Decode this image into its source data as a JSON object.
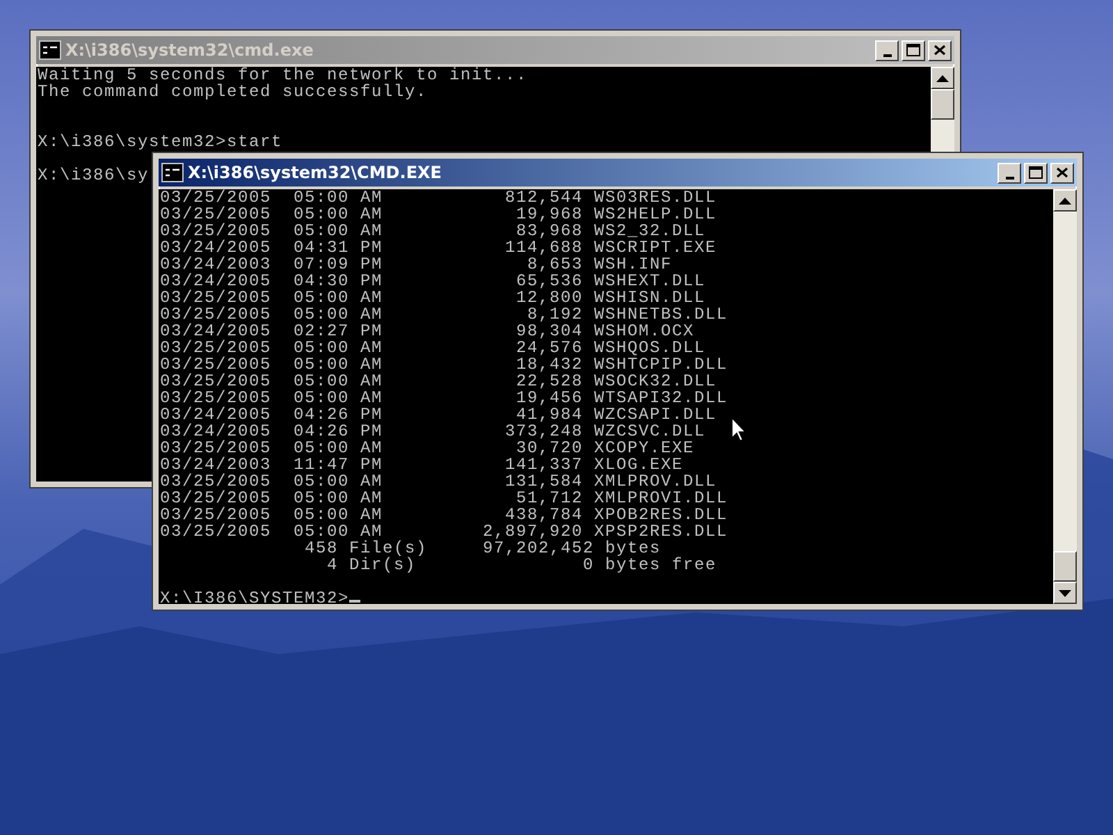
{
  "windows": [
    {
      "title": "X:\\i386\\system32\\cmd.exe",
      "active": false,
      "lines": [
        {
          "kind": "text",
          "text": "Waiting 5 seconds for the network to init..."
        },
        {
          "kind": "text",
          "text": "The command completed successfully."
        },
        {
          "kind": "blank"
        },
        {
          "kind": "blank"
        },
        {
          "kind": "text",
          "text": "X:\\i386\\system32>start"
        },
        {
          "kind": "blank"
        },
        {
          "kind": "text",
          "text": "X:\\i386\\sy"
        }
      ]
    },
    {
      "title": "X:\\i386\\system32\\CMD.EXE",
      "active": true,
      "lines": [
        {
          "kind": "text",
          "text": "03/25/2005  05:00 AM           812,544 WS03RES.DLL"
        },
        {
          "kind": "text",
          "text": "03/25/2005  05:00 AM            19,968 WS2HELP.DLL"
        },
        {
          "kind": "text",
          "text": "03/25/2005  05:00 AM            83,968 WS2_32.DLL"
        },
        {
          "kind": "text",
          "text": "03/24/2005  04:31 PM           114,688 WSCRIPT.EXE"
        },
        {
          "kind": "text",
          "text": "03/24/2003  07:09 PM             8,653 WSH.INF"
        },
        {
          "kind": "text",
          "text": "03/24/2005  04:30 PM            65,536 WSHEXT.DLL"
        },
        {
          "kind": "text",
          "text": "03/25/2005  05:00 AM            12,800 WSHISN.DLL"
        },
        {
          "kind": "text",
          "text": "03/25/2005  05:00 AM             8,192 WSHNETBS.DLL"
        },
        {
          "kind": "text",
          "text": "03/24/2005  02:27 PM            98,304 WSHOM.OCX"
        },
        {
          "kind": "text",
          "text": "03/25/2005  05:00 AM            24,576 WSHQOS.DLL"
        },
        {
          "kind": "text",
          "text": "03/25/2005  05:00 AM            18,432 WSHTCPIP.DLL"
        },
        {
          "kind": "text",
          "text": "03/25/2005  05:00 AM            22,528 WSOCK32.DLL"
        },
        {
          "kind": "text",
          "text": "03/25/2005  05:00 AM            19,456 WTSAPI32.DLL"
        },
        {
          "kind": "text",
          "text": "03/24/2005  04:26 PM            41,984 WZCSAPI.DLL"
        },
        {
          "kind": "text",
          "text": "03/24/2005  04:26 PM           373,248 WZCSVC.DLL"
        },
        {
          "kind": "text",
          "text": "03/25/2005  05:00 AM            30,720 XCOPY.EXE"
        },
        {
          "kind": "text",
          "text": "03/24/2003  11:47 PM           141,337 XLOG.EXE"
        },
        {
          "kind": "text",
          "text": "03/25/2005  05:00 AM           131,584 XMLPROV.DLL"
        },
        {
          "kind": "text",
          "text": "03/25/2005  05:00 AM            51,712 XMLPROVI.DLL"
        },
        {
          "kind": "text",
          "text": "03/25/2005  05:00 AM           438,784 XPOB2RES.DLL"
        },
        {
          "kind": "text",
          "text": "03/25/2005  05:00 AM         2,897,920 XPSP2RES.DLL"
        },
        {
          "kind": "text",
          "text": "             458 File(s)     97,202,452 bytes"
        },
        {
          "kind": "text",
          "text": "               4 Dir(s)               0 bytes free"
        },
        {
          "kind": "blank"
        },
        {
          "kind": "prompt",
          "text": "X:\\I386\\SYSTEM32>"
        }
      ]
    }
  ]
}
